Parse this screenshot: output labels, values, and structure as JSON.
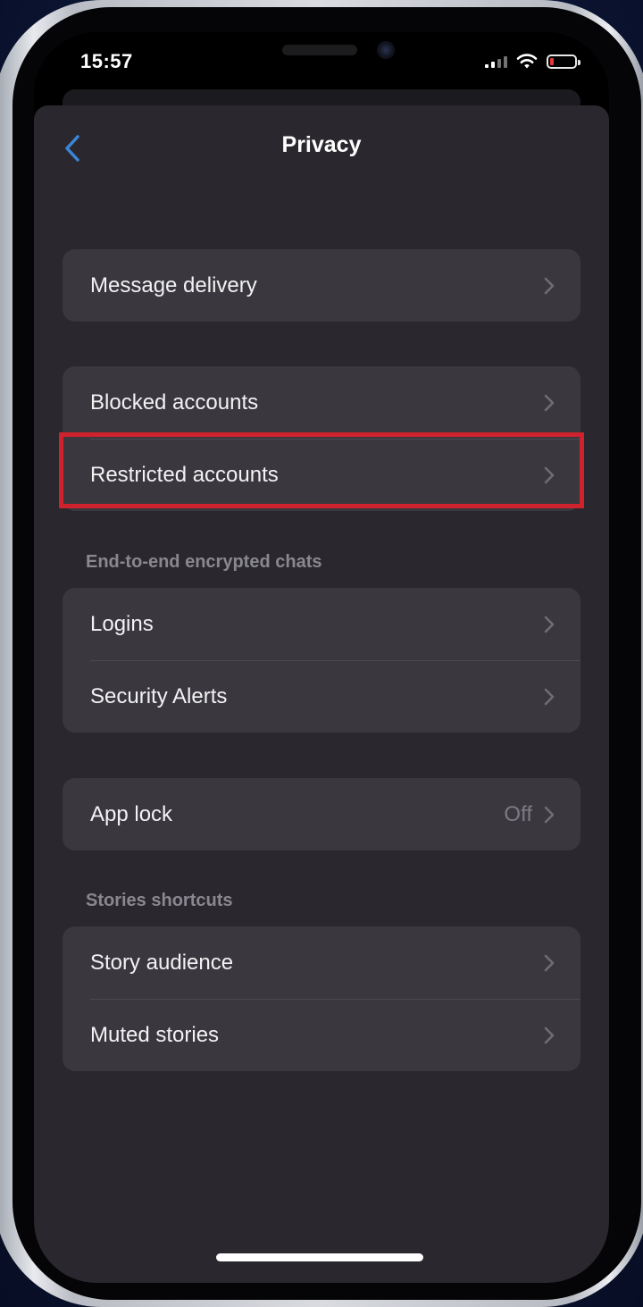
{
  "status_bar": {
    "time": "15:57",
    "icons": [
      "cellular-signal-icon",
      "wifi-icon",
      "battery-low-icon"
    ]
  },
  "nav": {
    "title": "Privacy",
    "back_icon": "chevron-left-icon"
  },
  "groups": {
    "message": {
      "items": [
        {
          "label": "Message delivery"
        }
      ]
    },
    "accounts": {
      "items": [
        {
          "label": "Blocked accounts"
        },
        {
          "label": "Restricted accounts",
          "highlighted": true
        }
      ]
    },
    "e2ee": {
      "header": "End-to-end encrypted chats",
      "items": [
        {
          "label": "Logins"
        },
        {
          "label": "Security Alerts"
        }
      ]
    },
    "applock": {
      "items": [
        {
          "label": "App lock",
          "value": "Off"
        }
      ]
    },
    "stories": {
      "header": "Stories shortcuts",
      "items": [
        {
          "label": "Story audience"
        },
        {
          "label": "Muted stories"
        }
      ]
    }
  },
  "colors": {
    "highlight": "#d0222c",
    "accent": "#3a86d8",
    "background": "#2a282e",
    "card": "#3a383e"
  }
}
